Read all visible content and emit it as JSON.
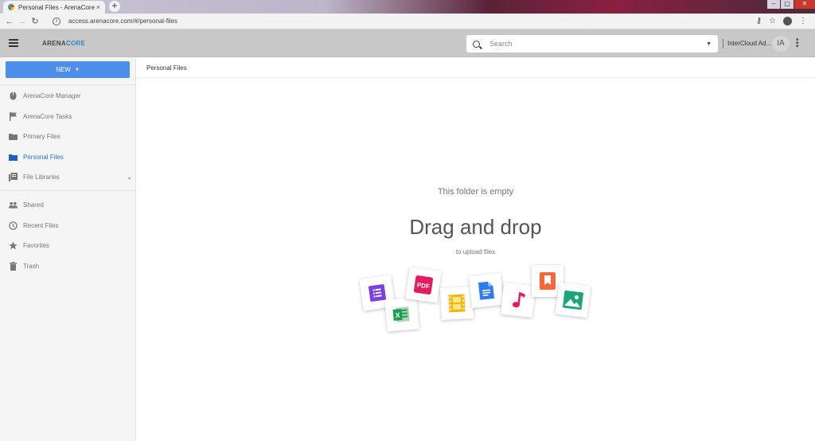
{
  "browser": {
    "tab_title": "Personal Files - ArenaCore",
    "tab_close": "×",
    "new_tab": "+",
    "url": "access.arenacore.com/#/personal-files"
  },
  "header": {
    "logo_main": "ARENA",
    "logo_accent": "CORE",
    "search_placeholder": "Search",
    "user_name": "InterCloud Ad...",
    "user_initials": "IA"
  },
  "sidebar": {
    "new_button": "NEW",
    "items": [
      {
        "label": "ArenaCore Manager",
        "icon": "mouse-icon"
      },
      {
        "label": "ArenaCore Tasks",
        "icon": "flag-icon"
      },
      {
        "label": "Primary Files",
        "icon": "folder-icon"
      },
      {
        "label": "Personal Files",
        "icon": "folder-icon",
        "active": true
      },
      {
        "label": "File Libraries",
        "icon": "library-icon",
        "expandable": true
      },
      {
        "label": "Shared",
        "icon": "people-icon"
      },
      {
        "label": "Recent Files",
        "icon": "clock-icon"
      },
      {
        "label": "Favorites",
        "icon": "star-icon"
      },
      {
        "label": "Trash",
        "icon": "trash-icon"
      }
    ]
  },
  "main": {
    "breadcrumb": "Personal Files",
    "empty_title": "This folder is empty",
    "drag_drop": "Drag and drop",
    "upload_hint": "to upload files",
    "file_type_icons": [
      "form-icon",
      "spreadsheet-icon",
      "pdf-icon",
      "video-icon",
      "document-icon",
      "music-icon",
      "bookmark-icon",
      "image-icon"
    ]
  },
  "colors": {
    "accent": "#4d8fe8",
    "active_nav": "#2a6fd6",
    "header_bg": "#c8c8c8"
  }
}
